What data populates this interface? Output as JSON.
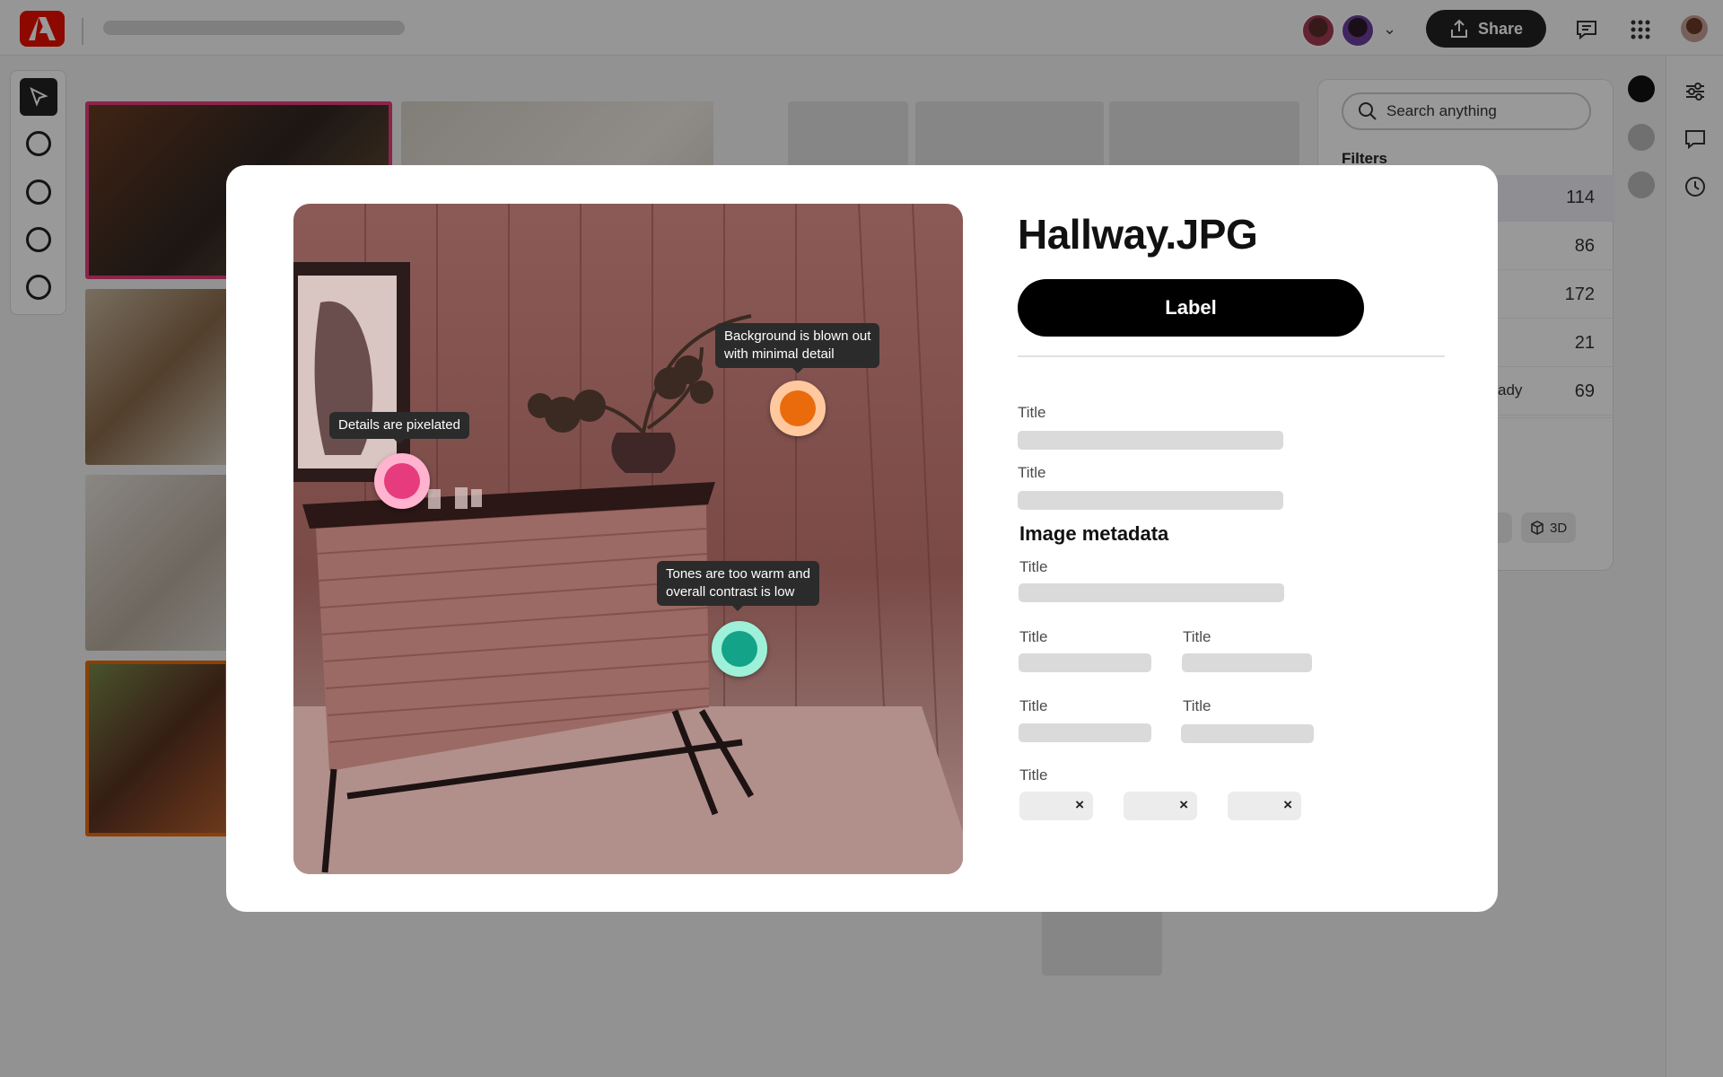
{
  "topbar": {
    "share_label": "Share"
  },
  "right_panel": {
    "search_placeholder": "Search anything",
    "filters_label": "Filters",
    "rows": [
      {
        "label": "",
        "count": "114"
      },
      {
        "label": "",
        "count": "86"
      },
      {
        "label": "",
        "count": "172"
      },
      {
        "label": "",
        "count": "21"
      },
      {
        "label": "ady",
        "count": "69"
      }
    ],
    "chip_3d": "3D"
  },
  "modal": {
    "file_name": "Hallway.JPG",
    "label_button": "Label",
    "annotations": [
      {
        "text": "Details are pixelated",
        "color": "#e63c7d"
      },
      {
        "text_line1": "Background is blown out",
        "text_line2": "with minimal detail",
        "color": "#ea6b0c"
      },
      {
        "text_line1": "Tones are too warm and",
        "text_line2": "overall contrast is low",
        "color": "#12a389"
      }
    ],
    "fields": {
      "title_1": "Title",
      "title_2": "Title",
      "metadata_heading": "Image metadata",
      "meta_title_1": "Title",
      "meta_title_2a": "Title",
      "meta_title_2b": "Title",
      "meta_title_3a": "Title",
      "meta_title_3b": "Title",
      "tags_title": "Title"
    },
    "tag_remove_glyph": "×"
  },
  "icons": {
    "app_logo": "adobe-logo-icon",
    "share": "share-icon",
    "comments": "comment-icon",
    "apps": "apps-grid-icon",
    "select_tool": "pointer-icon",
    "search": "search-icon",
    "adjust": "sliders-icon",
    "history": "clock-icon",
    "cube": "cube-icon"
  },
  "colors": {
    "accent_pink": "#e63c7d",
    "accent_orange": "#ea6b0c",
    "accent_teal": "#12a389",
    "brand_red": "#eb1000"
  }
}
